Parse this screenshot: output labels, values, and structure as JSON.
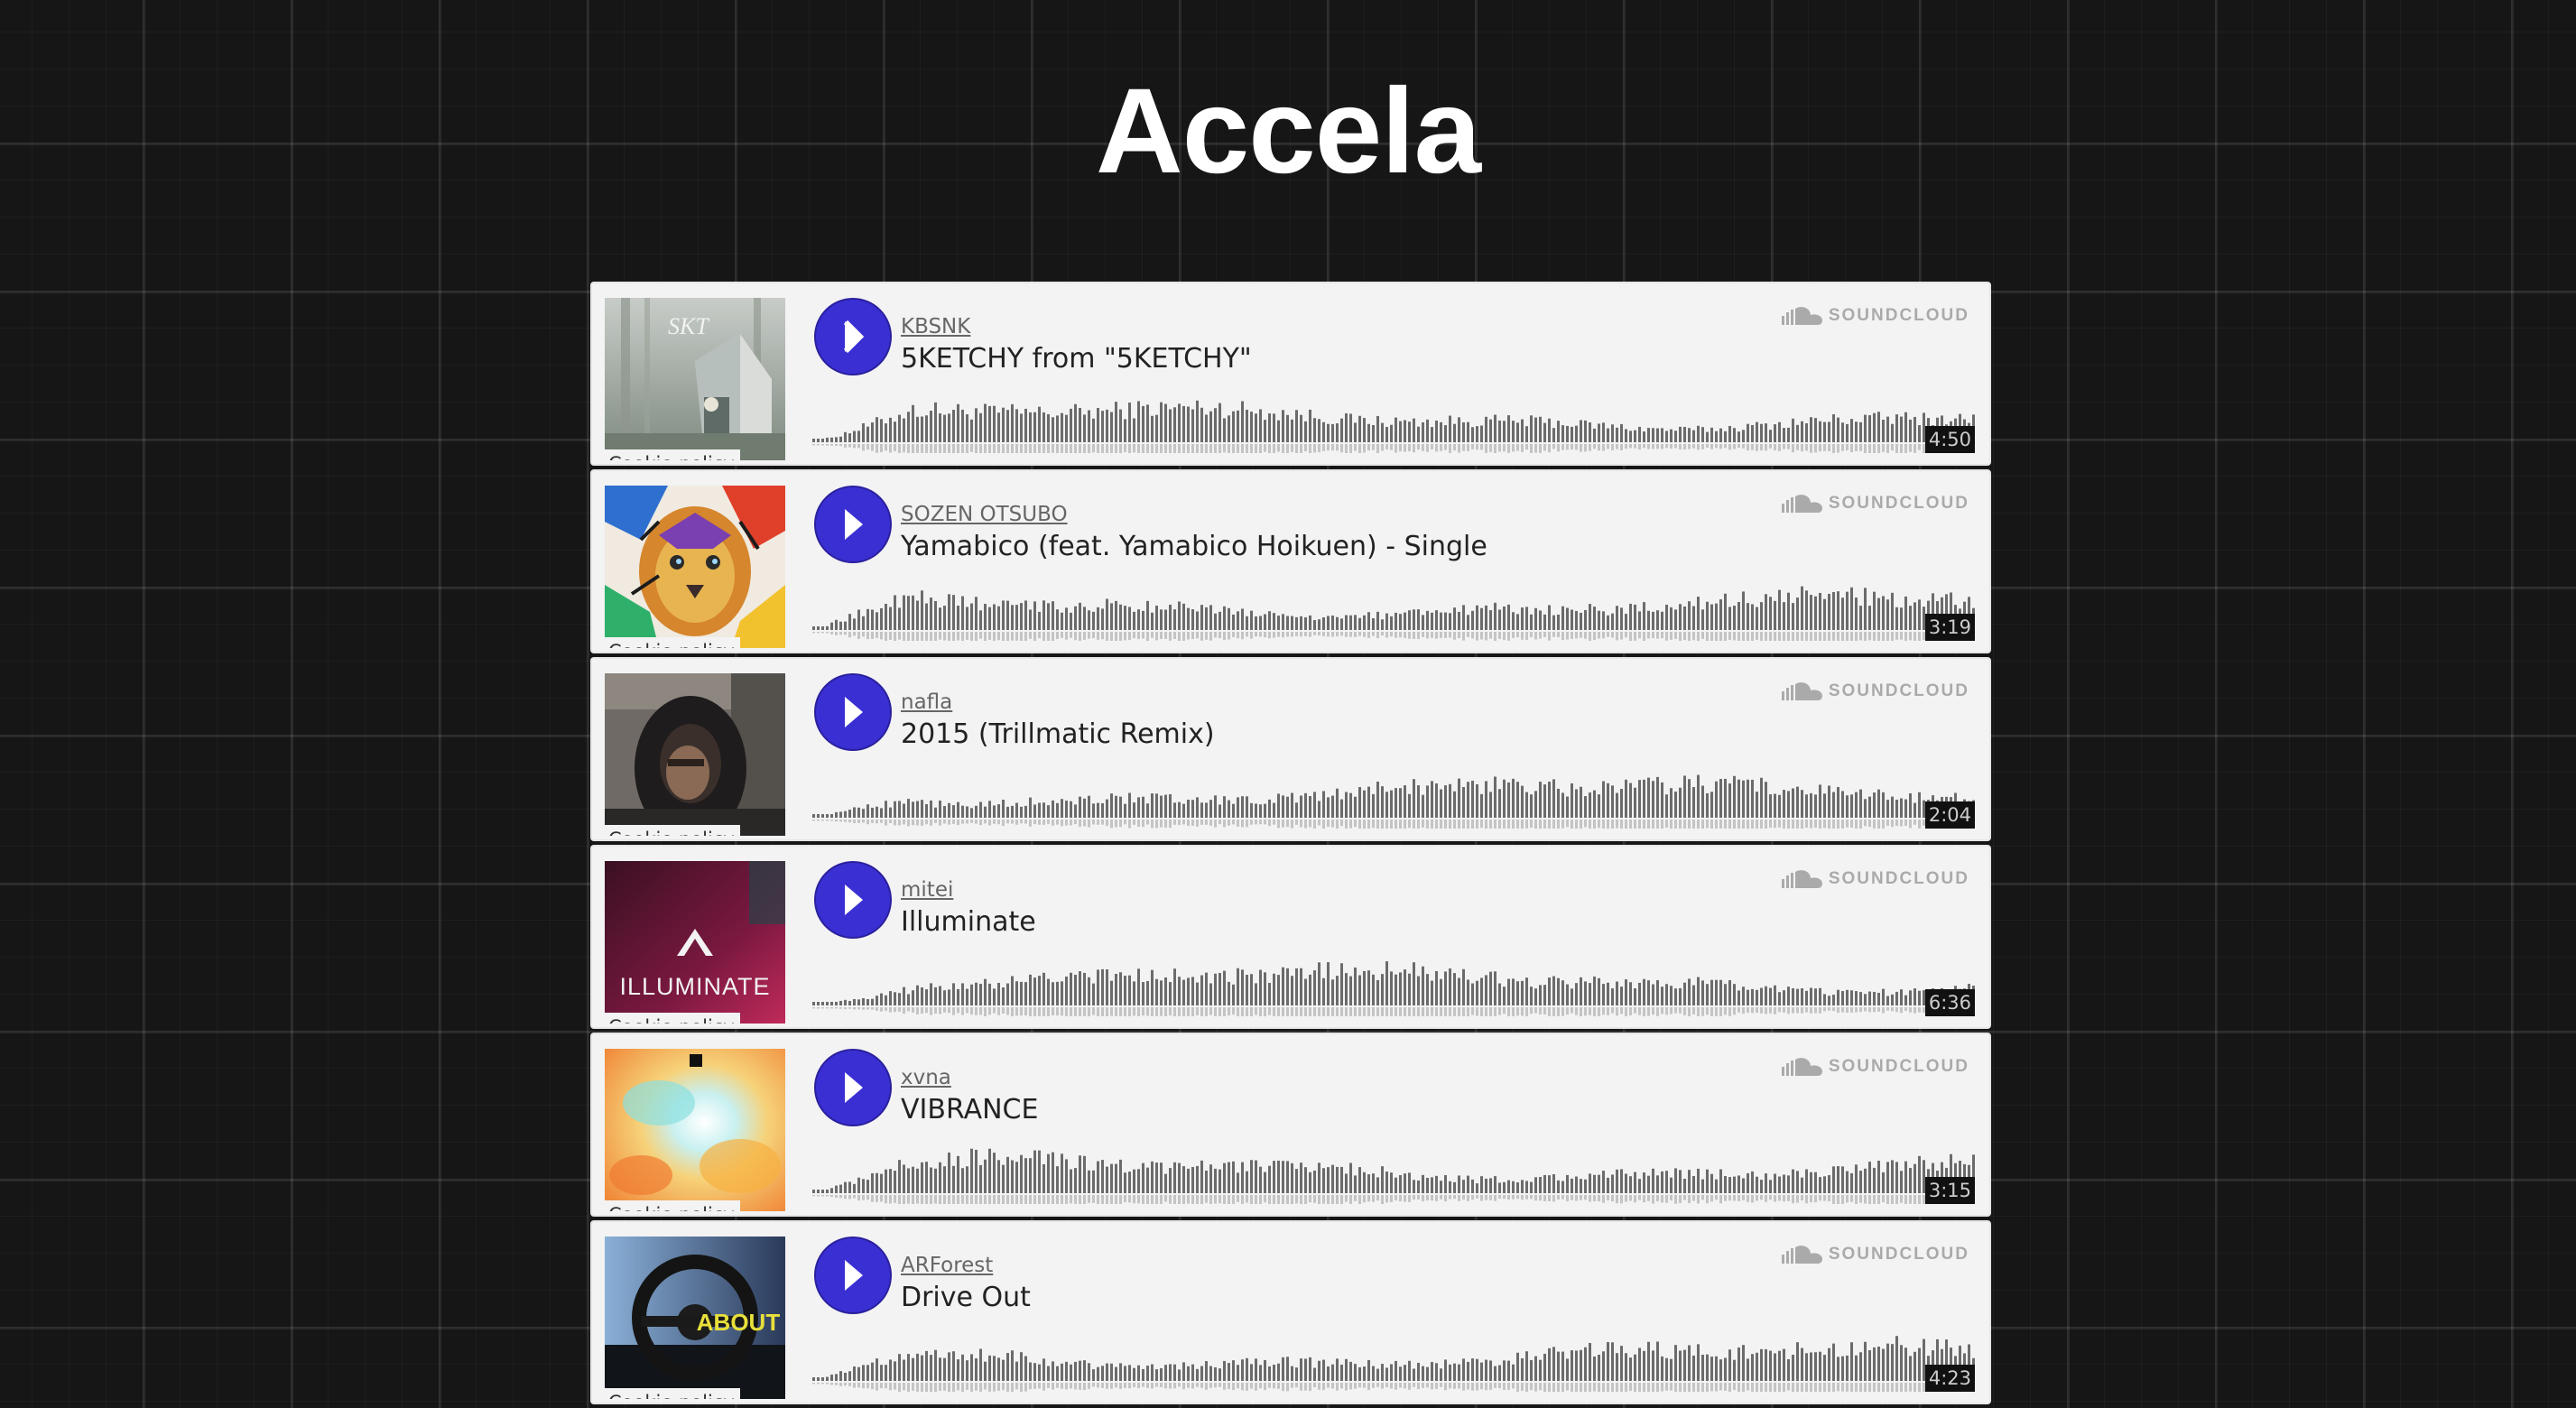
{
  "site": {
    "title": "Accela"
  },
  "tracks": [
    {
      "artist": "KBSNK",
      "title": "5KETCHY from \"5KETCHY\"",
      "duration": "4:50",
      "cookie": "Cookie policy",
      "brand": "SOUNDCLOUD"
    },
    {
      "artist": "SOZEN OTSUBO",
      "title": "Yamabico (feat. Yamabico Hoikuen) - Single",
      "duration": "3:19",
      "cookie": "Cookie policy",
      "brand": "SOUNDCLOUD"
    },
    {
      "artist": "nafla",
      "title": "2015 (Trillmatic Remix)",
      "duration": "2:04",
      "cookie": "Cookie policy",
      "brand": "SOUNDCLOUD"
    },
    {
      "artist": "mitei",
      "title": "Illuminate",
      "duration": "6:36",
      "cookie": "Cookie policy",
      "brand": "SOUNDCLOUD",
      "artwork_text": "ILLUMINATE"
    },
    {
      "artist": "xvna",
      "title": "VIBRANCE",
      "duration": "3:15",
      "cookie": "Cookie policy",
      "brand": "SOUNDCLOUD"
    },
    {
      "artist": "ARForest",
      "title": "Drive Out",
      "duration": "4:23",
      "cookie": "Cookie policy",
      "brand": "SOUNDCLOUD",
      "artwork_text": "ABOUT"
    }
  ],
  "colors": {
    "page_background": "#161616",
    "player_background": "#f3f3f3",
    "play_button": "#3a2fd2",
    "waveform": "#6b6b6b",
    "brand_gray": "#aaaaaa"
  },
  "icons": [
    "play-icon",
    "soundcloud-cloud-icon"
  ]
}
